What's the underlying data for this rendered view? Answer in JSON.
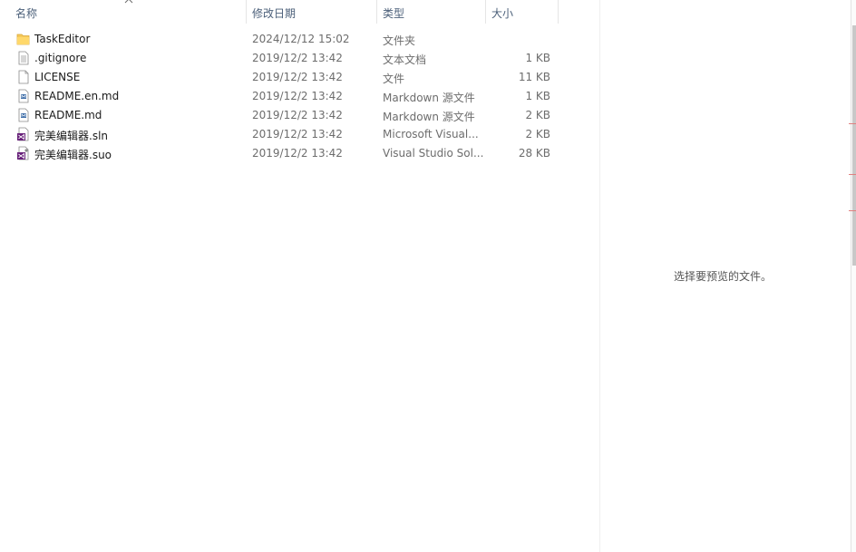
{
  "columns": {
    "name": "名称",
    "modified": "修改日期",
    "type": "类型",
    "size": "大小"
  },
  "files": [
    {
      "name": "TaskEditor",
      "modified": "2024/12/12 15:02",
      "type": "文件夹",
      "size": "",
      "icon": "folder-icon"
    },
    {
      "name": ".gitignore",
      "modified": "2019/12/2 13:42",
      "type": "文本文档",
      "size": "1 KB",
      "icon": "text-file-icon"
    },
    {
      "name": "LICENSE",
      "modified": "2019/12/2 13:42",
      "type": "文件",
      "size": "11 KB",
      "icon": "file-icon"
    },
    {
      "name": "README.en.md",
      "modified": "2019/12/2 13:42",
      "type": "Markdown 源文件",
      "size": "1 KB",
      "icon": "markdown-file-icon"
    },
    {
      "name": "README.md",
      "modified": "2019/12/2 13:42",
      "type": "Markdown 源文件",
      "size": "2 KB",
      "icon": "markdown-file-icon"
    },
    {
      "name": "完美编辑器.sln",
      "modified": "2019/12/2 13:42",
      "type": "Microsoft Visual...",
      "size": "2 KB",
      "icon": "visual-studio-solution-icon"
    },
    {
      "name": "完美编辑器.suo",
      "modified": "2019/12/2 13:42",
      "type": "Visual Studio Sol...",
      "size": "28 KB",
      "icon": "visual-studio-suo-icon"
    }
  ],
  "preview": {
    "message": "选择要预览的文件。"
  },
  "colors": {
    "header_text": "#4c607a",
    "folder": "#f6c95a",
    "vs_purple": "#68217a"
  }
}
